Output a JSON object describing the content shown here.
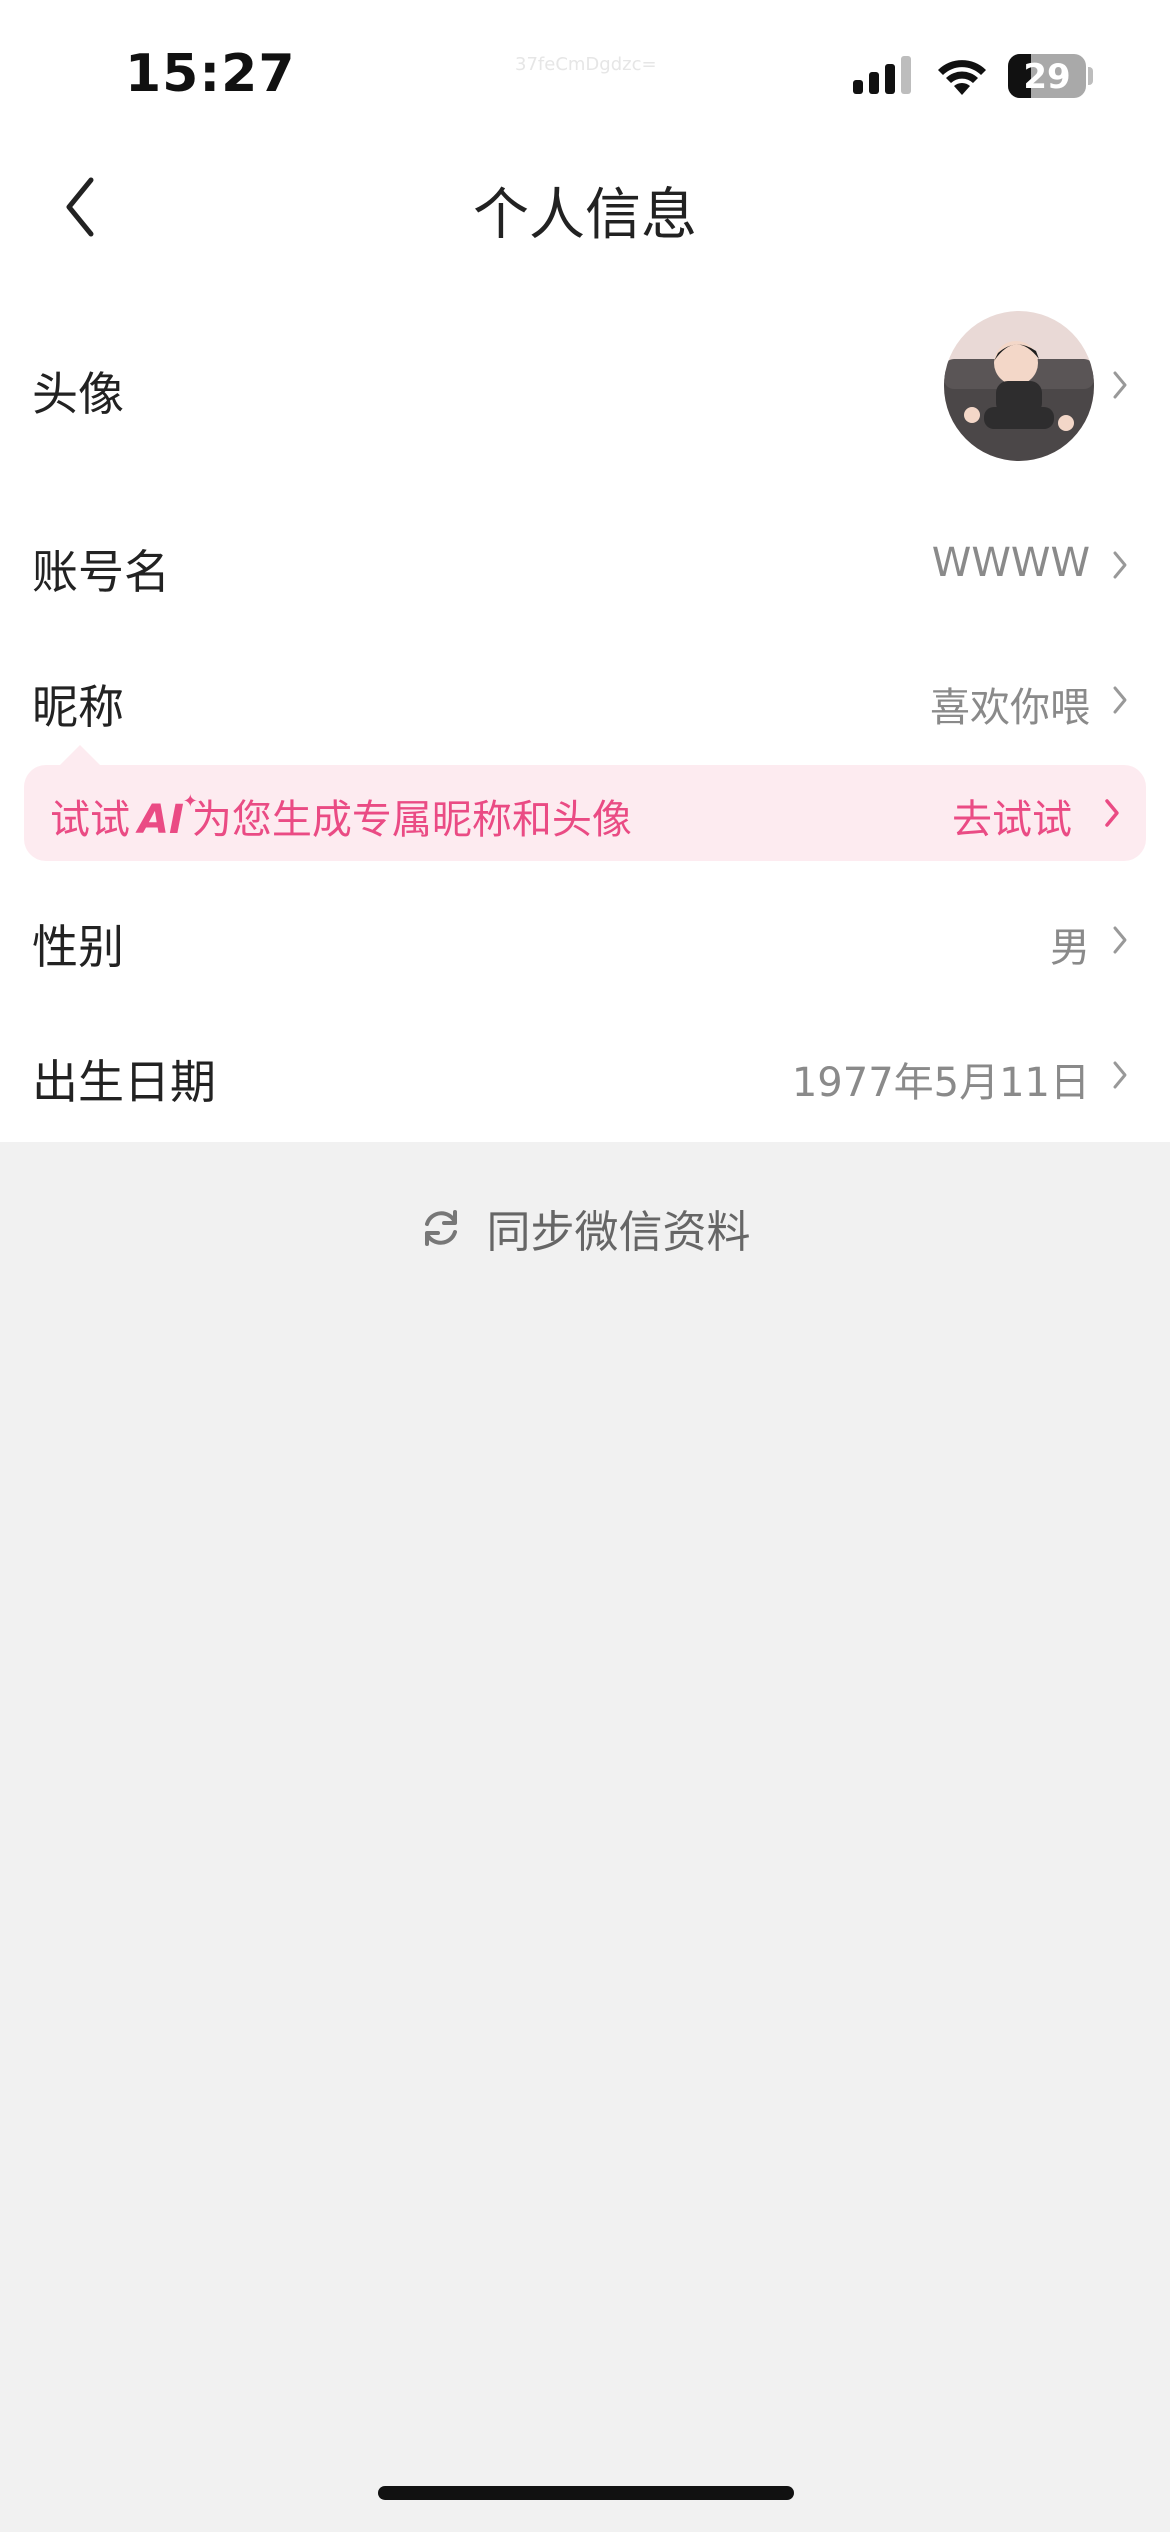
{
  "status_bar": {
    "time": "15:27",
    "id_text": "37feCmDgdzc=",
    "battery_level": "29",
    "battery_fraction": 0.29
  },
  "nav": {
    "back_icon": "chevron-left-icon",
    "title": "个人信息"
  },
  "rows": {
    "avatar": {
      "label": "头像"
    },
    "account": {
      "label": "账号名",
      "value": "WWWW"
    },
    "nickname": {
      "label": "昵称",
      "value": "喜欢你喂"
    },
    "gender": {
      "label": "性别",
      "value": "男"
    },
    "birthday": {
      "label": "出生日期",
      "value": "1977年5月11日"
    }
  },
  "ai_banner": {
    "prefix": "试试",
    "badge": "AI",
    "suffix": "为您生成专属昵称和头像",
    "action": "去试试"
  },
  "sync": {
    "label": "同步微信资料",
    "icon": "refresh-icon"
  },
  "colors": {
    "accent": "#ea4b84",
    "banner_bg": "#fdebf0",
    "page_bg": "#f1f1f1"
  }
}
